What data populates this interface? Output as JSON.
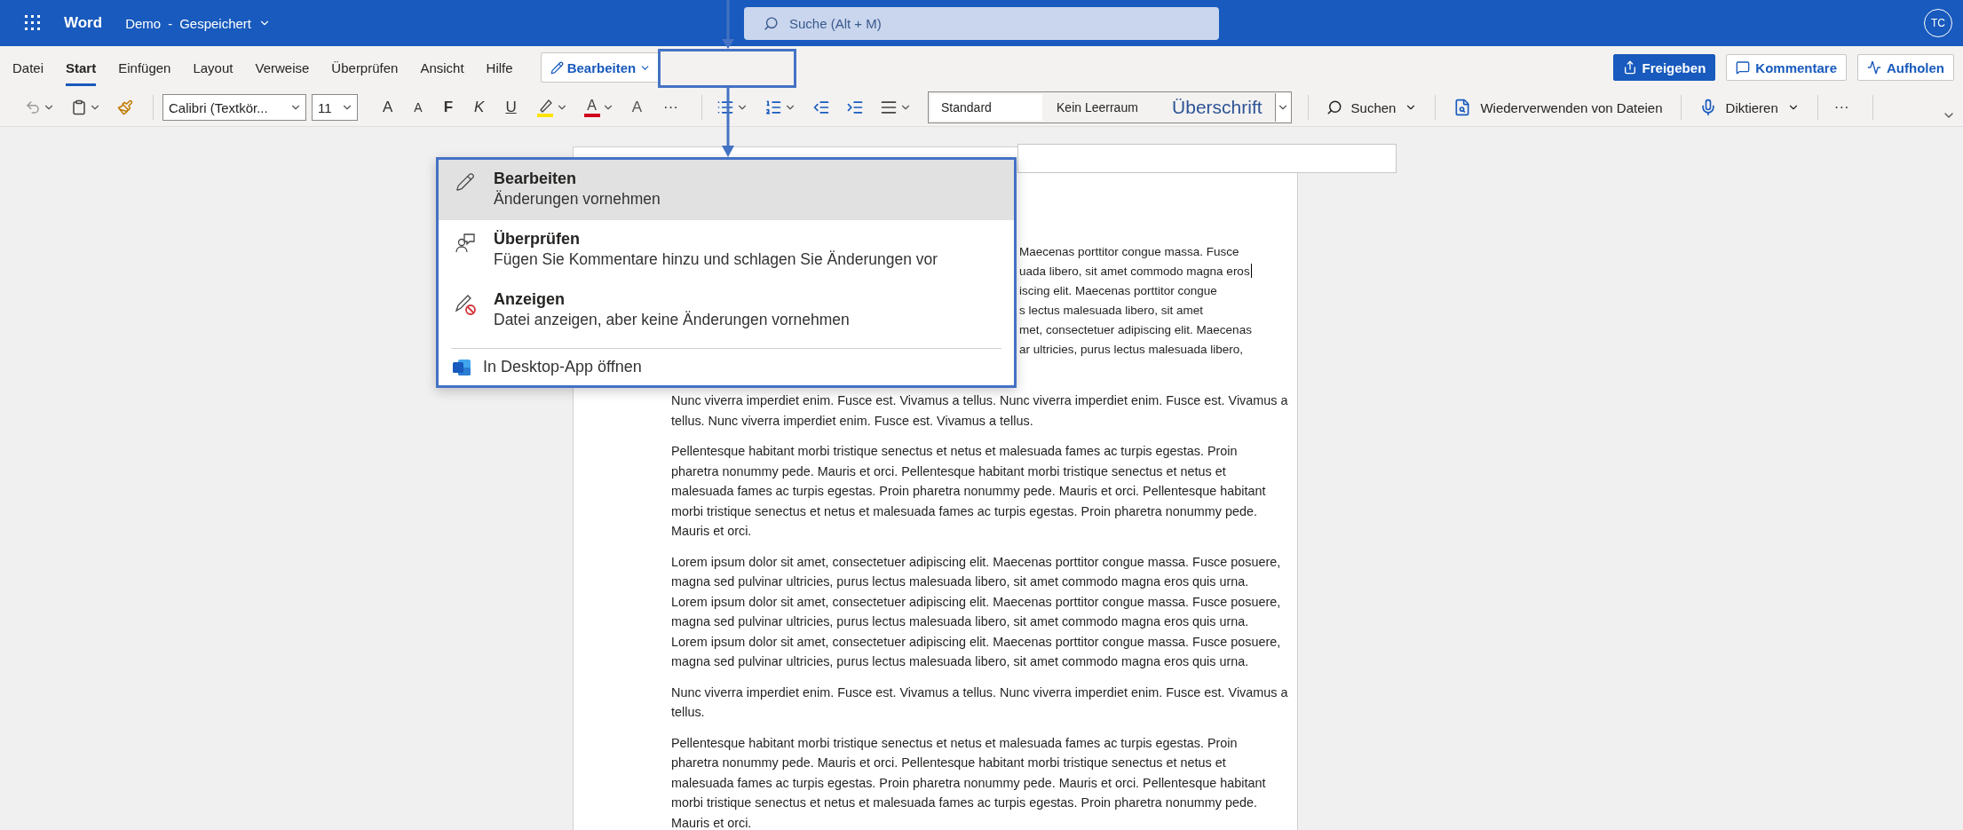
{
  "title_bar": {
    "app": "Word",
    "document": "Demo",
    "separator": "-",
    "status": "Gespeichert",
    "search_placeholder": "Suche (Alt + M)",
    "avatar": "TC"
  },
  "ribbon_tabs": [
    {
      "label": "Datei",
      "selected": false
    },
    {
      "label": "Start",
      "selected": true
    },
    {
      "label": "Einfügen",
      "selected": false
    },
    {
      "label": "Layout",
      "selected": false
    },
    {
      "label": "Verweise",
      "selected": false
    },
    {
      "label": "Überprüfen",
      "selected": false
    },
    {
      "label": "Ansicht",
      "selected": false
    },
    {
      "label": "Hilfe",
      "selected": false
    }
  ],
  "mode_button": {
    "label": "Bearbeiten"
  },
  "actions": [
    {
      "label": "Freigeben",
      "kind": "primary"
    },
    {
      "label": "Kommentare",
      "kind": "comment"
    },
    {
      "label": "Aufholen",
      "kind": "catchup"
    }
  ],
  "toolbar": {
    "font_name": "Calibri (Textkör...",
    "font_size": "11",
    "grow_font": "A",
    "shrink_font": "A",
    "bold": "F",
    "italic": "K",
    "underline": "U",
    "font_color": "A",
    "clear_formatting": "A",
    "more": "···",
    "styles": [
      {
        "label": "Standard",
        "kind": "normal",
        "selected": true
      },
      {
        "label": "Kein Leerraum",
        "kind": "normal",
        "selected": false
      },
      {
        "label": "Überschrift",
        "kind": "heading",
        "selected": false
      }
    ],
    "search": "Suchen",
    "reuse_files": "Wiederverwenden von Dateien",
    "dictate": "Diktieren",
    "overflow": "···"
  },
  "mode_menu": {
    "items": [
      {
        "kind": "edit",
        "title": "Bearbeiten",
        "description": "Änderungen vornehmen",
        "selected": true
      },
      {
        "kind": "review",
        "title": "Überprüfen",
        "description": "Fügen Sie Kommentare hinzu und schlagen Sie Änderungen vor",
        "selected": false
      },
      {
        "kind": "view",
        "title": "Anzeigen",
        "description": "Datei anzeigen, aber keine Änderungen vornehmen",
        "selected": false
      }
    ],
    "footer": "In Desktop-App öffnen"
  },
  "document": {
    "fragments": [
      "Maecenas porttitor congue massa. Fusce",
      "uada libero, sit amet commodo magna eros",
      "iscing elit. Maecenas porttitor congue",
      "s lectus malesuada libero, sit amet",
      "met, consectetuer adipiscing elit. Maecenas",
      "ar ultricies, purus lectus malesuada libero,"
    ],
    "paragraphs": [
      "Nunc viverra imperdiet enim. Fusce est. Vivamus a tellus. Nunc viverra imperdiet enim. Fusce est. Vivamus a tellus. Nunc viverra imperdiet enim. Fusce est. Vivamus a tellus.",
      "Pellentesque habitant morbi tristique senectus et netus et malesuada fames ac turpis egestas. Proin pharetra nonummy pede. Mauris et orci. Pellentesque habitant morbi tristique senectus et netus et malesuada fames ac turpis egestas. Proin pharetra nonummy pede. Mauris et orci. Pellentesque habitant morbi tristique senectus et netus et malesuada fames ac turpis egestas. Proin pharetra nonummy pede. Mauris et orci.",
      "Lorem ipsum dolor sit amet, consectetuer adipiscing elit. Maecenas porttitor congue massa. Fusce posuere, magna sed pulvinar ultricies, purus lectus malesuada libero, sit amet commodo magna eros quis urna. Lorem ipsum dolor sit amet, consectetuer adipiscing elit. Maecenas porttitor congue massa. Fusce posuere, magna sed pulvinar ultricies, purus lectus malesuada libero, sit amet commodo magna eros quis urna. Lorem ipsum dolor sit amet, consectetuer adipiscing elit. Maecenas porttitor congue massa. Fusce posuere, magna sed pulvinar ultricies, purus lectus malesuada libero, sit amet commodo magna eros quis urna.",
      "Nunc viverra imperdiet enim. Fusce est. Vivamus a tellus. Nunc viverra imperdiet enim. Fusce est. Vivamus a tellus.",
      "Pellentesque habitant morbi tristique senectus et netus et malesuada fames ac turpis egestas. Proin pharetra nonummy pede. Mauris et orci. Pellentesque habitant morbi tristique senectus et netus et malesuada fames ac turpis egestas. Proin pharetra nonummy pede. Mauris et orci. Pellentesque habitant morbi tristique senectus et netus et malesuada fames ac turpis egestas. Proin pharetra nonummy pede. Mauris et orci."
    ]
  }
}
